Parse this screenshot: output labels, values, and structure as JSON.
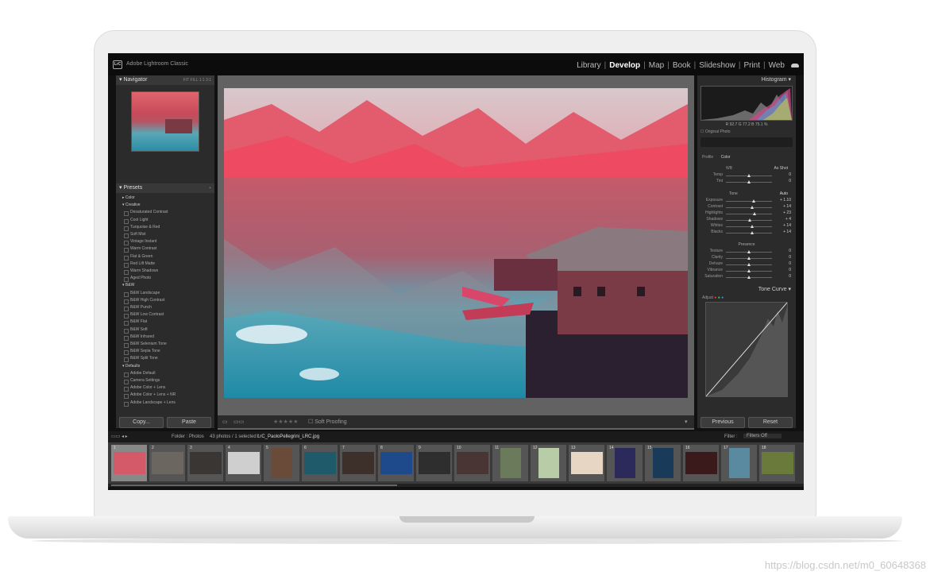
{
  "app": {
    "logo_text": "LrC",
    "title": "Adobe Lightroom Classic"
  },
  "modules": [
    {
      "label": "Library",
      "active": false
    },
    {
      "label": "Develop",
      "active": true
    },
    {
      "label": "Map",
      "active": false
    },
    {
      "label": "Book",
      "active": false
    },
    {
      "label": "Slideshow",
      "active": false
    },
    {
      "label": "Print",
      "active": false
    },
    {
      "label": "Web",
      "active": false
    }
  ],
  "navigator": {
    "title": "Navigator",
    "options": "FIT  FILL  1:1  3:1"
  },
  "presets": {
    "title": "Presets",
    "items": [
      {
        "type": "group",
        "label": "▸ Color"
      },
      {
        "type": "group",
        "label": "▾ Creative"
      },
      {
        "type": "item",
        "label": "Desaturated Contrast"
      },
      {
        "type": "item",
        "label": "Cool Light"
      },
      {
        "type": "item",
        "label": "Turquoise & Red"
      },
      {
        "type": "item",
        "label": "Soft Mist"
      },
      {
        "type": "item",
        "label": "Vintage Instant"
      },
      {
        "type": "item",
        "label": "Warm Contrast"
      },
      {
        "type": "item",
        "label": "Flat & Green"
      },
      {
        "type": "item",
        "label": "Red Lift Matte"
      },
      {
        "type": "item",
        "label": "Warm Shadows"
      },
      {
        "type": "item",
        "label": "Aged Photo"
      },
      {
        "type": "group",
        "label": "▾ B&W"
      },
      {
        "type": "item",
        "label": "B&W Landscape"
      },
      {
        "type": "item",
        "label": "B&W High Contrast"
      },
      {
        "type": "item",
        "label": "B&W Punch"
      },
      {
        "type": "item",
        "label": "B&W Low Contrast"
      },
      {
        "type": "item",
        "label": "B&W Flat"
      },
      {
        "type": "item",
        "label": "B&W Soft"
      },
      {
        "type": "item",
        "label": "B&W Infrared"
      },
      {
        "type": "item",
        "label": "B&W Selenium Tone"
      },
      {
        "type": "item",
        "label": "B&W Sepia Tone"
      },
      {
        "type": "item",
        "label": "B&W Split Tone"
      },
      {
        "type": "group",
        "label": "▾ Defaults"
      },
      {
        "type": "item",
        "label": "Adobe Default"
      },
      {
        "type": "item",
        "label": "Camera Settings"
      },
      {
        "type": "item",
        "label": "Adobe Color + Lens"
      },
      {
        "type": "item",
        "label": "Adobe Color + Lens + NR"
      },
      {
        "type": "item",
        "label": "Adobe Landscape + Lens"
      }
    ]
  },
  "left_buttons": {
    "copy": "Copy...",
    "paste": "Paste"
  },
  "toolbar": {
    "soft_proofing": "Soft Proofing"
  },
  "histogram": {
    "title": "Histogram",
    "values": "R 92.7  G 77.2  B 75.1 %",
    "original_photo": "Original Photo"
  },
  "basic": {
    "profile_label": "Profile",
    "profile_value": "Color",
    "wb_label": "WB",
    "wb_value": "As Shot",
    "tone_label": "Tone",
    "auto_label": "Auto",
    "presence_label": "Presence",
    "sliders": [
      {
        "label": "Temp",
        "value": "0",
        "level": 0.5
      },
      {
        "label": "Tint",
        "value": "0",
        "level": 0.5
      },
      {
        "label": "Exposure",
        "value": "+ 1.10",
        "level": 0.6
      },
      {
        "label": "Contrast",
        "value": "+ 14",
        "level": 0.57
      },
      {
        "label": "Highlights",
        "value": "+ 23",
        "level": 0.62
      },
      {
        "label": "Shadows",
        "value": "+ 4",
        "level": 0.52
      },
      {
        "label": "Whites",
        "value": "+ 14",
        "level": 0.57
      },
      {
        "label": "Blacks",
        "value": "+ 14",
        "level": 0.57
      },
      {
        "label": "Texture",
        "value": "0",
        "level": 0.5
      },
      {
        "label": "Clarity",
        "value": "0",
        "level": 0.5
      },
      {
        "label": "Dehaze",
        "value": "0",
        "level": 0.5
      },
      {
        "label": "Vibrance",
        "value": "0",
        "level": 0.5
      },
      {
        "label": "Saturation",
        "value": "0",
        "level": 0.5
      }
    ]
  },
  "tone_curve": {
    "title": "Tone Curve",
    "adjust_label": "Adjust"
  },
  "right_buttons": {
    "previous": "Previous",
    "reset": "Reset"
  },
  "filmbar": {
    "folder": "Folder : Photos",
    "count": "43 photos / 1 selected /",
    "filename": "LrC_PaoloPellegrini_LRC.jpg",
    "filter_label": "Filter :",
    "filter_value": "Filters Off"
  },
  "filmstrip": [
    {
      "num": "1",
      "color": "#d45a6a",
      "selected": true,
      "tall": false
    },
    {
      "num": "2",
      "color": "#6b6660",
      "selected": false,
      "tall": false
    },
    {
      "num": "3",
      "color": "#3a3633",
      "selected": false,
      "tall": false
    },
    {
      "num": "4",
      "color": "#cfcfcf",
      "selected": false,
      "tall": false
    },
    {
      "num": "5",
      "color": "#6a4b3a",
      "selected": false,
      "tall": true
    },
    {
      "num": "6",
      "color": "#1f5a6a",
      "selected": false,
      "tall": false
    },
    {
      "num": "7",
      "color": "#3d2f2a",
      "selected": false,
      "tall": false
    },
    {
      "num": "8",
      "color": "#1e4a8c",
      "selected": false,
      "tall": false
    },
    {
      "num": "9",
      "color": "#2e2e2e",
      "selected": false,
      "tall": false
    },
    {
      "num": "10",
      "color": "#4a3535",
      "selected": false,
      "tall": false
    },
    {
      "num": "11",
      "color": "#6a7a5a",
      "selected": false,
      "tall": true
    },
    {
      "num": "12",
      "color": "#b8cca8",
      "selected": false,
      "tall": true
    },
    {
      "num": "13",
      "color": "#e8d6c4",
      "selected": false,
      "tall": false
    },
    {
      "num": "14",
      "color": "#2b2a5a",
      "selected": false,
      "tall": true
    },
    {
      "num": "15",
      "color": "#1a3a5a",
      "selected": false,
      "tall": true
    },
    {
      "num": "16",
      "color": "#3a1a1a",
      "selected": false,
      "tall": false
    },
    {
      "num": "17",
      "color": "#5a8aa0",
      "selected": false,
      "tall": true
    },
    {
      "num": "18",
      "color": "#6a7a3a",
      "selected": false,
      "tall": false
    }
  ],
  "watermark": "https://blog.csdn.net/m0_60648368"
}
